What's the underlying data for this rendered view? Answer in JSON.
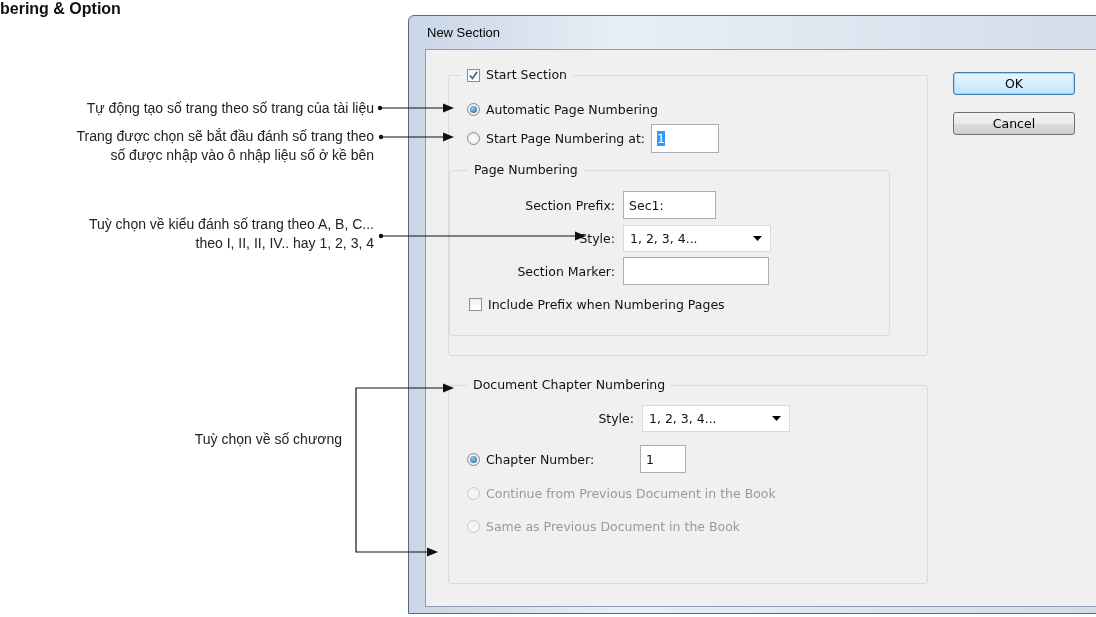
{
  "heading": "bering & Option",
  "annotations": [
    {
      "text": "Tự động tạo số trang theo số trang của tài liệu"
    },
    {
      "text": "Trang được chọn sẽ bắt đầu đánh số trang theo\nsố được nhập vào ô nhập liệu số ở kề bên"
    },
    {
      "text": "Tuỳ chọn về kiểu đánh số trang theo A, B, C...\ntheo I, II, II, IV.. hay 1, 2, 3, 4"
    },
    {
      "text": "Tuỳ chọn về số chương"
    }
  ],
  "dialog": {
    "title": "New Section",
    "start_section": {
      "label": "Start Section",
      "checked": true
    },
    "numbering_options": [
      {
        "label": "Automatic Page Numbering",
        "selected": true
      },
      {
        "label": "Start Page Numbering at:",
        "selected": false,
        "value": "1",
        "value_highlighted": true
      }
    ],
    "page_numbering": {
      "title": "Page Numbering",
      "section_prefix": {
        "label": "Section Prefix:",
        "value": "Sec1:"
      },
      "style": {
        "label": "Style:",
        "value": "1, 2, 3, 4..."
      },
      "section_marker": {
        "label": "Section Marker:"
      },
      "include_prefix": {
        "label": "Include Prefix when Numbering Pages",
        "checked": false
      }
    },
    "chapter_numbering": {
      "title": "Document Chapter Numbering",
      "style": {
        "label": "Style:",
        "value": "1, 2, 3, 4..."
      },
      "options": [
        {
          "label": "Chapter Number:",
          "selected": true,
          "disabled": false,
          "value": "1"
        },
        {
          "label": "Continue from Previous Document in the Book",
          "selected": false,
          "disabled": true
        },
        {
          "label": "Same as Previous Document in the Book",
          "selected": false,
          "disabled": true
        }
      ]
    },
    "buttons": [
      {
        "label": "OK",
        "default": true
      },
      {
        "label": "Cancel",
        "default": false
      }
    ]
  }
}
